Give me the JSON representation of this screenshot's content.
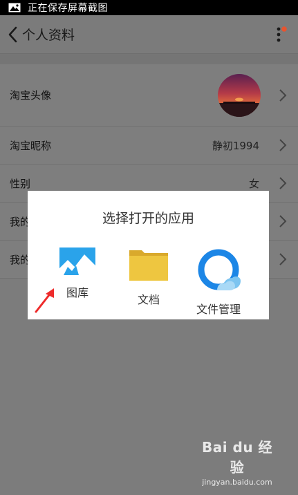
{
  "status_bar": {
    "text": "正在保存屏幕截图",
    "icon": "image-icon"
  },
  "app_bar": {
    "title": "个人资料",
    "back_icon": "chevron-left-icon",
    "menu_icon": "more-vertical-icon",
    "badge_color": "#e8542f"
  },
  "profile_rows": [
    {
      "label": "淘宝头像",
      "value": ""
    },
    {
      "label": "淘宝昵称",
      "value": "静初1994"
    },
    {
      "label": "性别",
      "value": "女"
    },
    {
      "label": "我的",
      "value": ""
    },
    {
      "label": "我的",
      "value": ""
    }
  ],
  "dialog": {
    "title": "选择打开的应用",
    "apps": [
      {
        "label": "图库",
        "icon": "gallery-icon"
      },
      {
        "label": "文档",
        "icon": "folder-icon"
      },
      {
        "label": "文件管理",
        "icon": "file-manager-icon"
      }
    ]
  },
  "watermark": {
    "title": "Bai du 经验",
    "url": "jingyan.baidu.com"
  },
  "colors": {
    "dim_overlay": "#7b7b7b",
    "dialog_bg": "#ffffff",
    "gallery_blue": "#2aa3ea",
    "folder_yellow": "#eec640",
    "qq_blue": "#1c86e6",
    "annotation_red": "#ee2b2b"
  }
}
